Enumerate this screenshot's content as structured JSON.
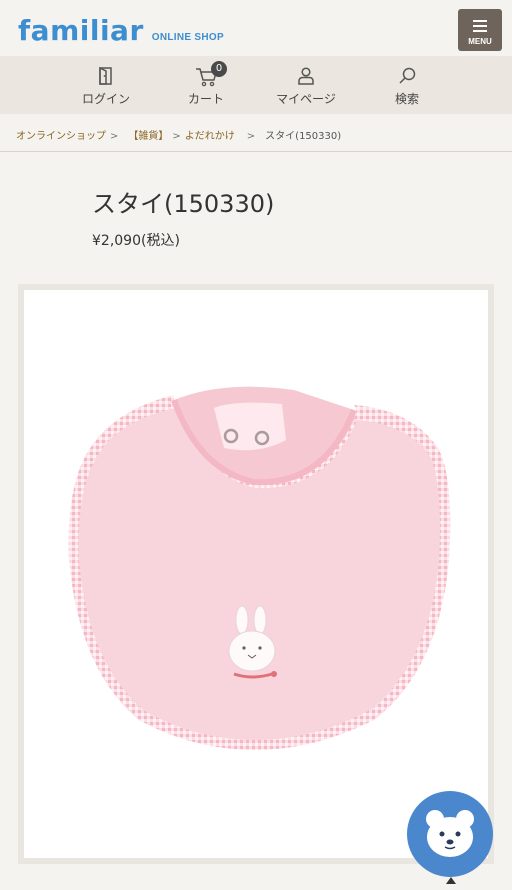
{
  "header": {
    "logo_word": "familiar",
    "logo_sub": "ONLINE SHOP",
    "menu_label": "MENU"
  },
  "nav": {
    "items": [
      {
        "label": "ログイン",
        "icon": "login-door-icon"
      },
      {
        "label": "カート",
        "icon": "cart-icon",
        "badge": "0"
      },
      {
        "label": "マイページ",
        "icon": "person-icon"
      },
      {
        "label": "検索",
        "icon": "search-icon"
      }
    ]
  },
  "breadcrumb": {
    "items": [
      "オンラインショップ",
      "【雑貨】",
      "よだれかけ"
    ],
    "separators": [
      ">",
      ">",
      ">"
    ],
    "current": "スタイ(150330)"
  },
  "product": {
    "title": "スタイ(150330)",
    "price": "¥2,090(税込)",
    "image_alt": "pink bib with bunny applique"
  },
  "colors": {
    "brand_blue": "#3d8ed0",
    "menu_bg": "#6e645c",
    "nav_bg": "#ebe6df",
    "breadcrumb_link": "#8a6420",
    "chat_bubble": "#4b87cc",
    "bib_pink": "#f8d4dc"
  }
}
